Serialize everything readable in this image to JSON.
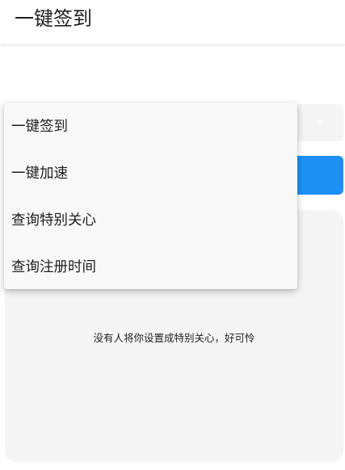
{
  "header": {
    "title": "一键签到"
  },
  "select": {
    "value": ""
  },
  "dropdown": {
    "items": [
      {
        "label": "一键签到"
      },
      {
        "label": "一键加速"
      },
      {
        "label": "查询特别关心"
      },
      {
        "label": "查询注册时间"
      }
    ]
  },
  "action_button": {
    "label": ""
  },
  "result": {
    "message": "没有人将你设置成特别关心，好可怜"
  },
  "colors": {
    "accent": "#1e90f5",
    "panel": "#f4f4f4"
  }
}
